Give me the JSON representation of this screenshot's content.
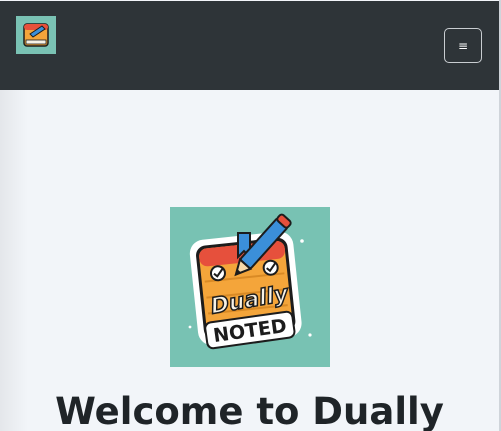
{
  "navbar": {
    "brand_logo_icon": "dually-noted-logo-icon",
    "menu_toggle_glyph": "≡",
    "menu_toggle_icon": "hamburger-menu-icon"
  },
  "hero": {
    "logo_text_line1": "Dually",
    "logo_text_line2": "NOTED",
    "title": "Welcome to Dually"
  },
  "colors": {
    "navbar_bg": "#2e3438",
    "page_bg": "#f2f5f9",
    "logo_bg": "#78c2b3",
    "title_text": "#1f2428"
  }
}
